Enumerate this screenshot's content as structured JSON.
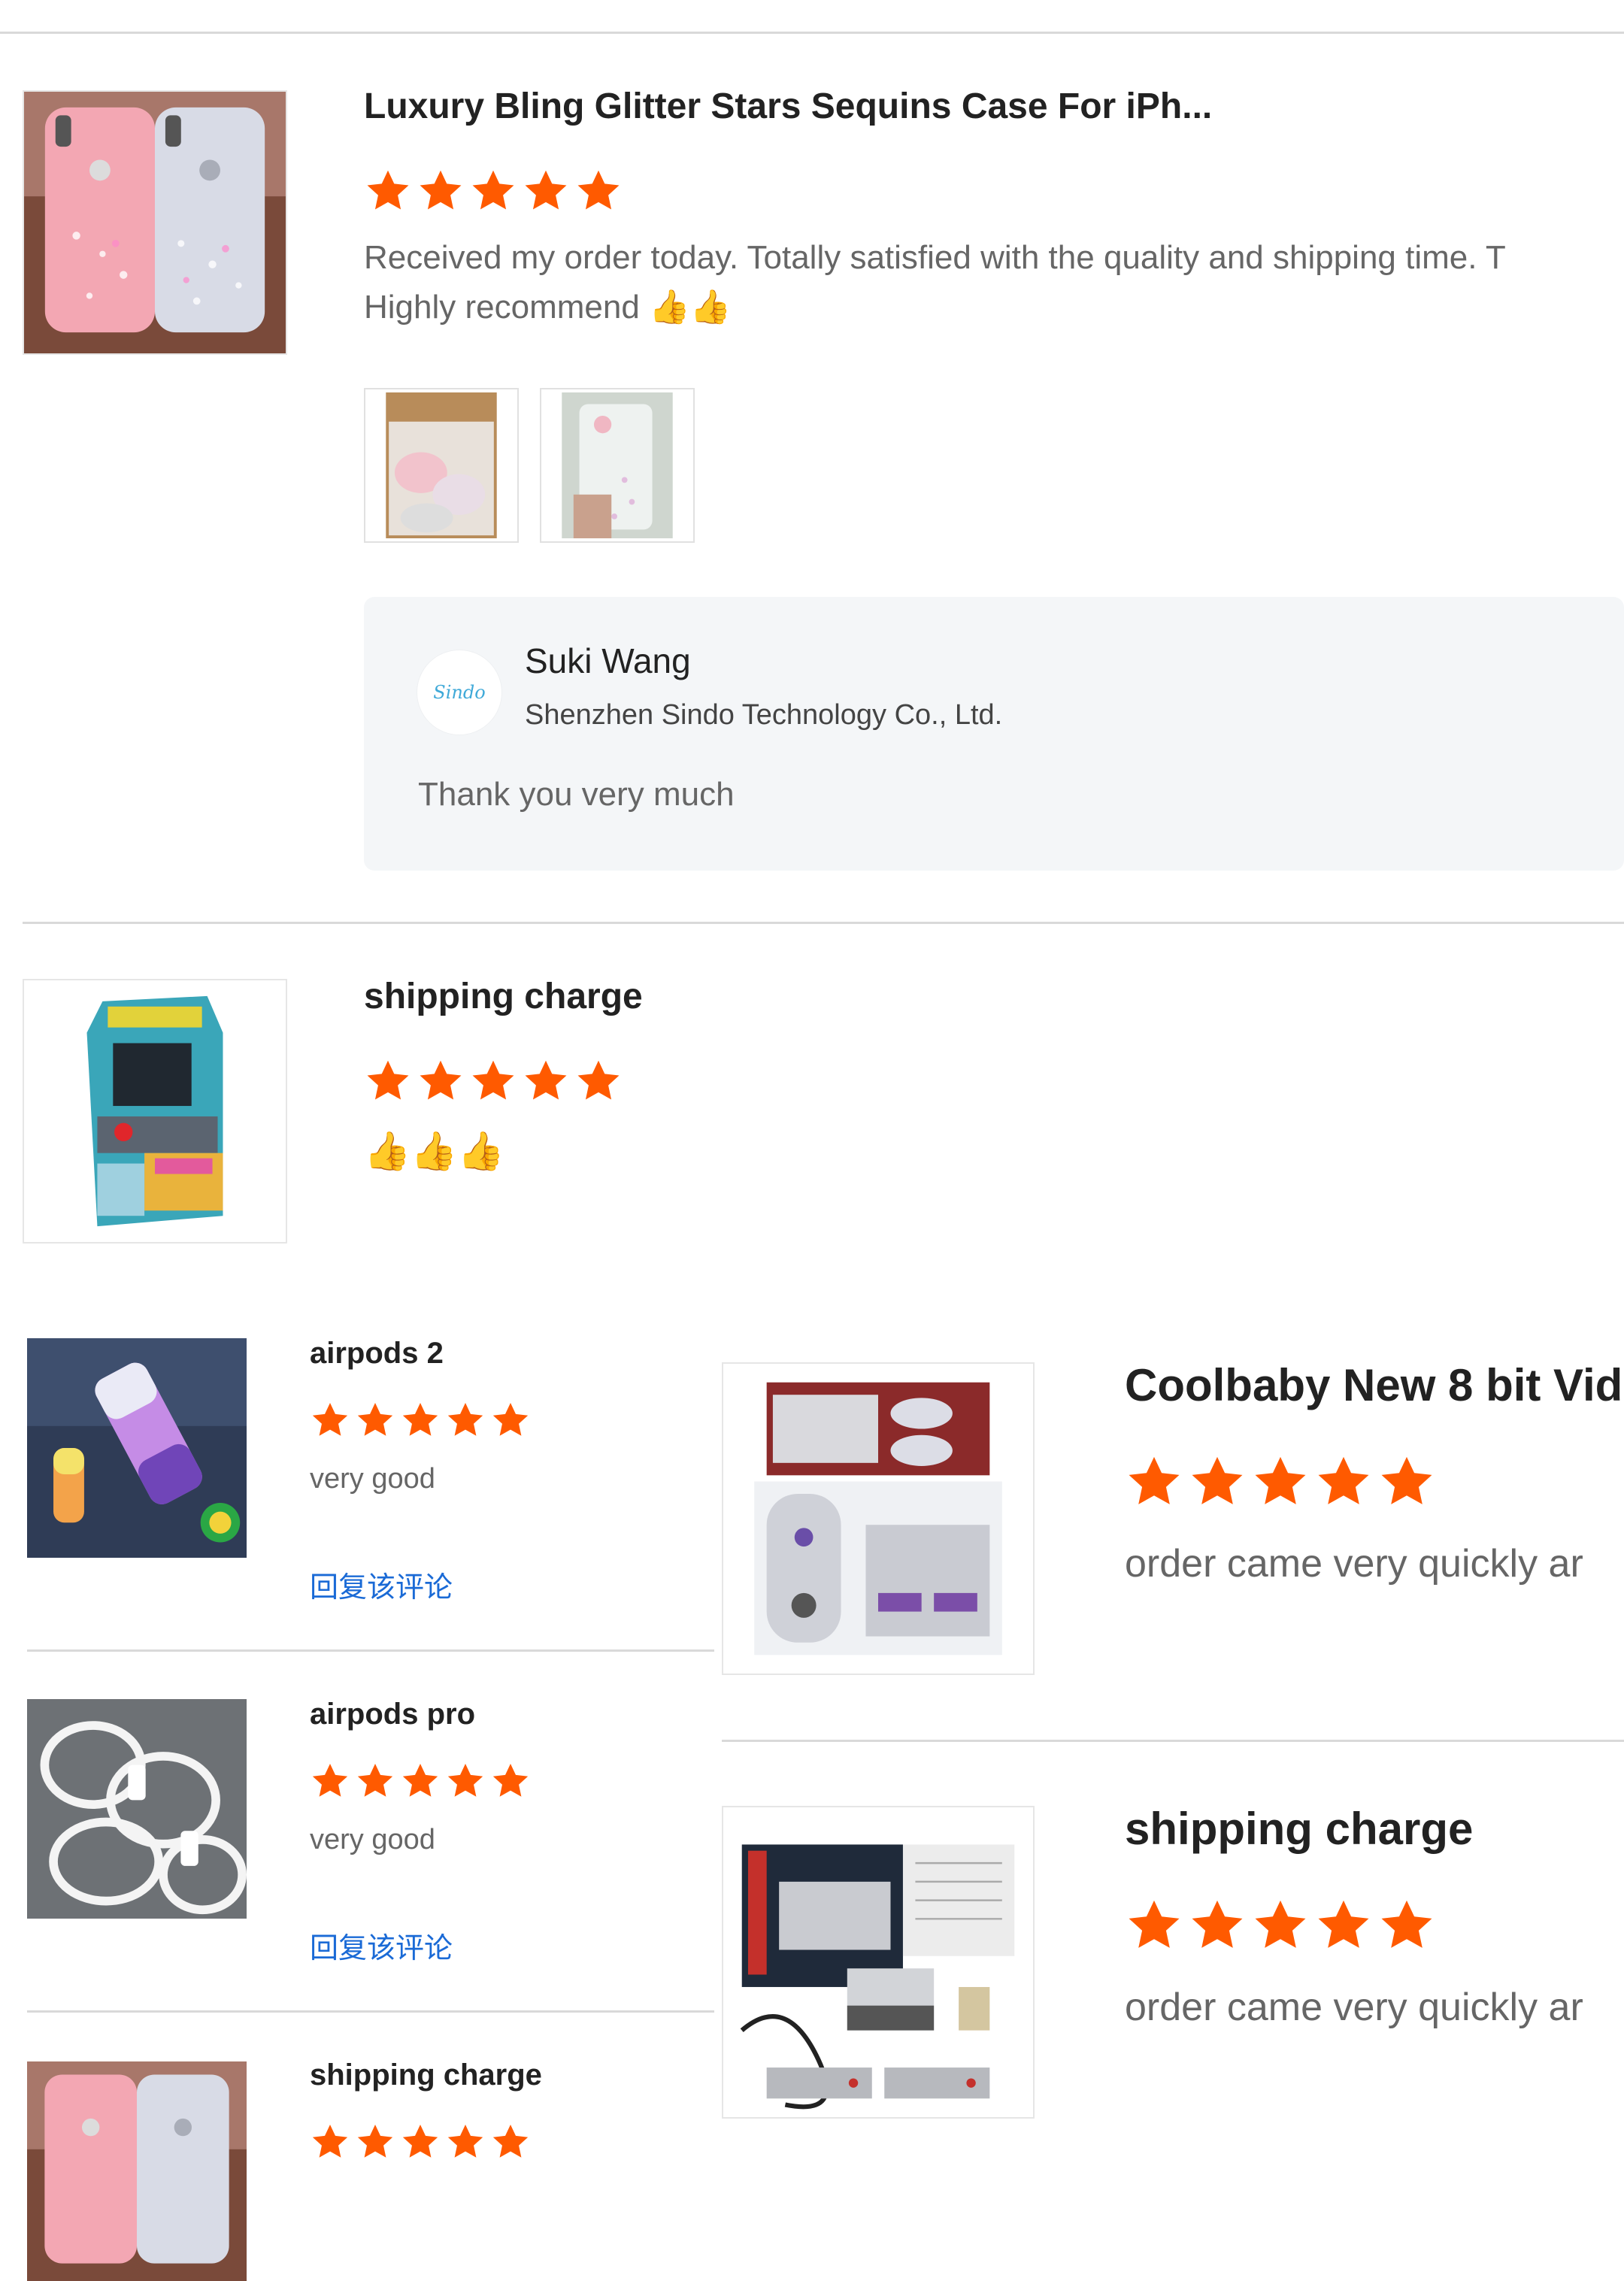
{
  "colors": {
    "star": "#ff5a00",
    "link": "#1a6ad6",
    "divider": "#d9d9d9"
  },
  "reviews": [
    {
      "title": "Luxury Bling Glitter Stars Sequins Case For iPh...",
      "rating": 5,
      "text_line1": "Received my order today. Totally satisfied with the quality and shipping time. T",
      "text_line2": "Highly recommend",
      "emoji": "👍👍",
      "product_icon": "phone-case-image",
      "seller_reply": {
        "name": "Suki Wang",
        "company": "Shenzhen Sindo Technology Co., Ltd.",
        "logo_text": "Sindo",
        "message": "Thank you very much"
      }
    },
    {
      "title": "shipping charge",
      "rating": 5,
      "emoji": "👍👍👍",
      "product_icon": "mini-arcade-image"
    }
  ],
  "left_list": [
    {
      "title": "airpods 2",
      "rating": 5,
      "text": "very good",
      "reply_label": "回复该评论",
      "product_icon": "speaker-image"
    },
    {
      "title": "airpods pro",
      "rating": 5,
      "text": "very good",
      "reply_label": "回复该评论",
      "product_icon": "cables-image"
    },
    {
      "title": "shipping charge",
      "rating": 5,
      "product_icon": "phone-case-image"
    }
  ],
  "right_list": [
    {
      "title": "Coolbaby New 8 bit Vid",
      "rating": 5,
      "text": "order came very quickly ar",
      "product_icon": "snes-console-image"
    },
    {
      "title": "shipping charge",
      "rating": 5,
      "text": "order came very quickly ar",
      "product_icon": "nes-console-image"
    }
  ]
}
